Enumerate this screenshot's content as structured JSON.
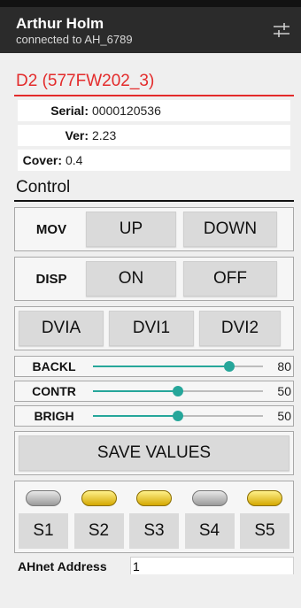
{
  "appbar": {
    "title": "Arthur Holm",
    "subtitle": "connected to AH_6789",
    "settings_icon": "sliders-icon"
  },
  "device": {
    "name": "D2 (577FW202_3)",
    "info": [
      {
        "label": "Serial:",
        "value": "0000120536"
      },
      {
        "label": "Ver:",
        "value": "2.23"
      },
      {
        "label": "Cover:",
        "value": "0.4"
      }
    ]
  },
  "control": {
    "title": "Control",
    "mov": {
      "label": "MOV",
      "up": "UP",
      "down": "DOWN"
    },
    "disp": {
      "label": "DISP",
      "on": "ON",
      "off": "OFF"
    },
    "inputs": {
      "a": "DVIA",
      "b": "DVI1",
      "c": "DVI2"
    },
    "sliders": [
      {
        "label": "BACKL",
        "value": "80",
        "level": 0.8
      },
      {
        "label": "CONTR",
        "value": "50",
        "level": 0.5
      },
      {
        "label": "BRIGH",
        "value": "50",
        "level": 0.5
      }
    ],
    "save": "SAVE VALUES",
    "leds": [
      {
        "label": "S1",
        "state": "off"
      },
      {
        "label": "S2",
        "state": "on"
      },
      {
        "label": "S3",
        "state": "on"
      },
      {
        "label": "S4",
        "state": "off"
      },
      {
        "label": "S5",
        "state": "on"
      }
    ],
    "ahnet": {
      "label": "AHnet Address",
      "value": "1"
    }
  },
  "colors": {
    "accent_red": "#e32b2b",
    "slider_teal": "#26a69a",
    "led_on": "#f2c200",
    "appbar": "#2b2b2b"
  }
}
